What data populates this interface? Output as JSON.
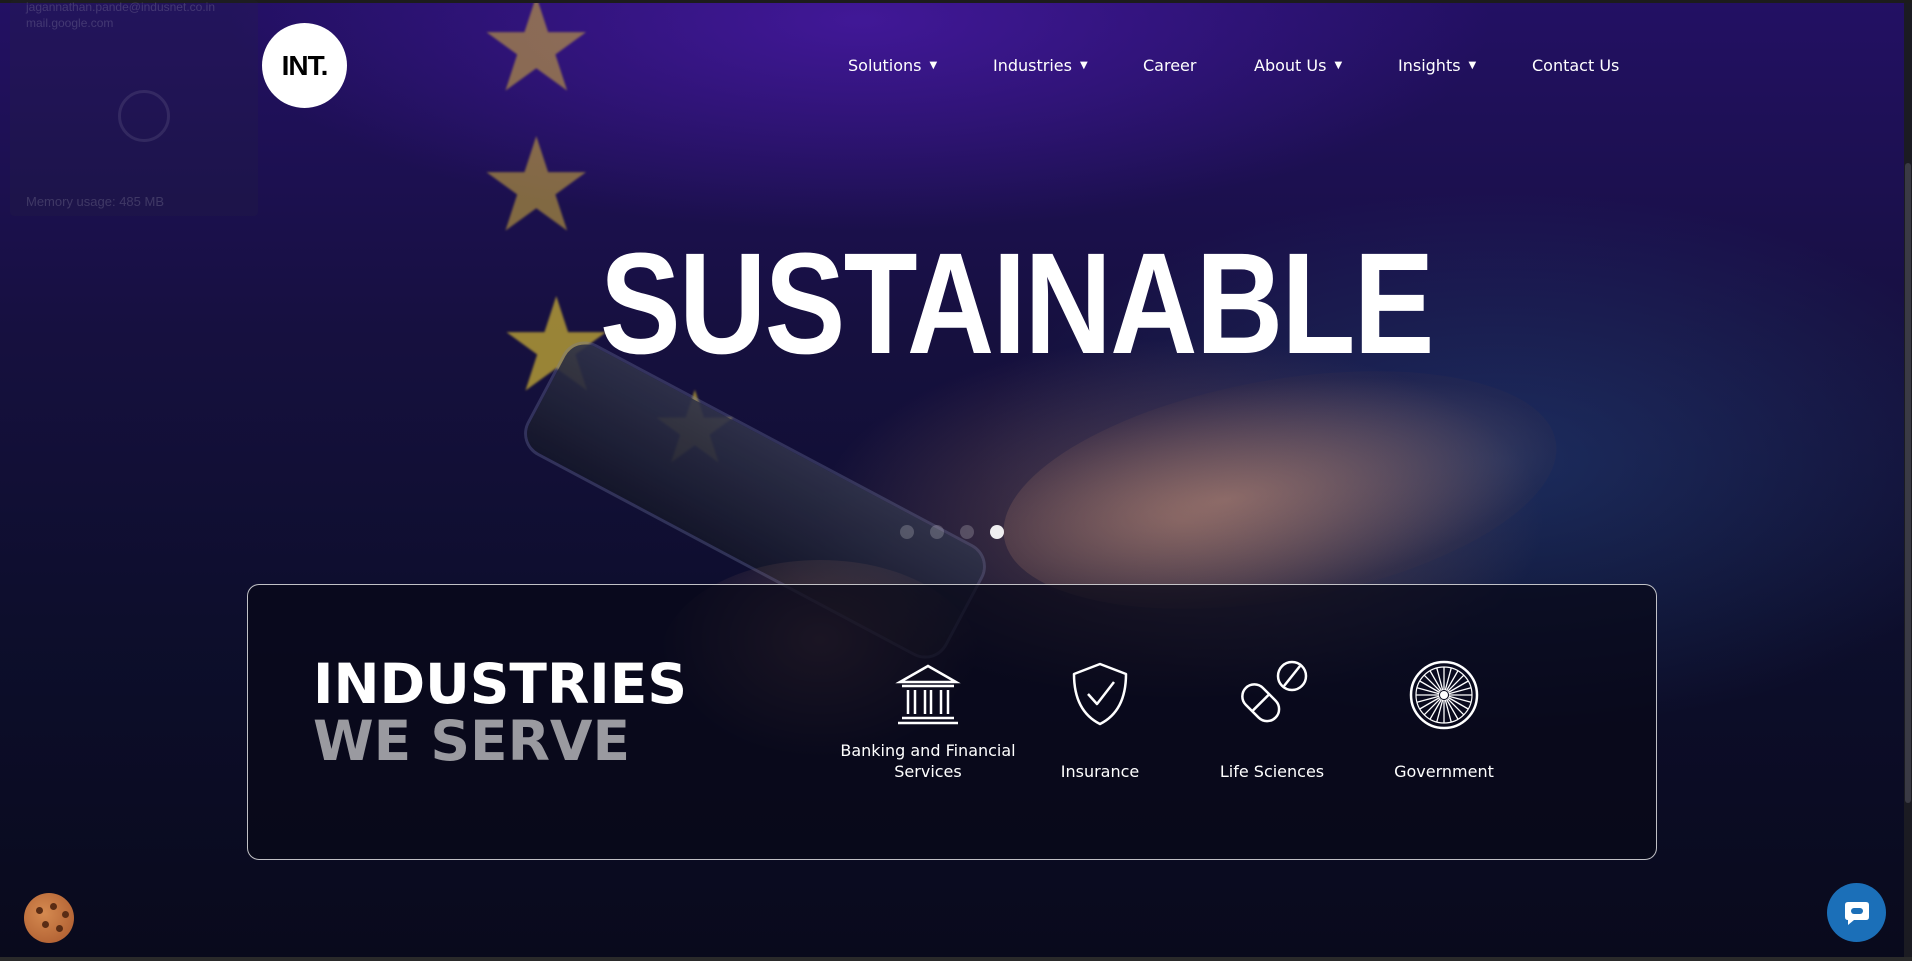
{
  "tooltip": {
    "line1": "jagannathan.pande@indusnet.co.in",
    "line2": "mail.google.com",
    "memory": "Memory usage: 485 MB"
  },
  "logo": {
    "text": "INT."
  },
  "nav": {
    "items": [
      {
        "label": "Solutions",
        "has_dropdown": true
      },
      {
        "label": "Industries",
        "has_dropdown": true
      },
      {
        "label": "Career",
        "has_dropdown": false
      },
      {
        "label": "About Us",
        "has_dropdown": true
      },
      {
        "label": "Insights",
        "has_dropdown": true
      },
      {
        "label": "Contact Us",
        "has_dropdown": false
      }
    ],
    "caret": "▼"
  },
  "hero": {
    "headline": "SUSTAINABLE",
    "carousel": {
      "slides": 4,
      "active": 4
    }
  },
  "industries": {
    "title_line1": "INDUSTRIES",
    "title_line2": "WE SERVE",
    "items": [
      {
        "label": "Banking and Financial Services",
        "icon": "bank-icon"
      },
      {
        "label": "Insurance",
        "icon": "shield-check-icon"
      },
      {
        "label": "Life Sciences",
        "icon": "pill-icon"
      },
      {
        "label": "Government",
        "icon": "ashoka-chakra-icon"
      }
    ]
  },
  "colors": {
    "accent_chat": "#1b6fb8",
    "subtitle_gray": "#9a9aa0",
    "background": "#0a0b1e"
  }
}
